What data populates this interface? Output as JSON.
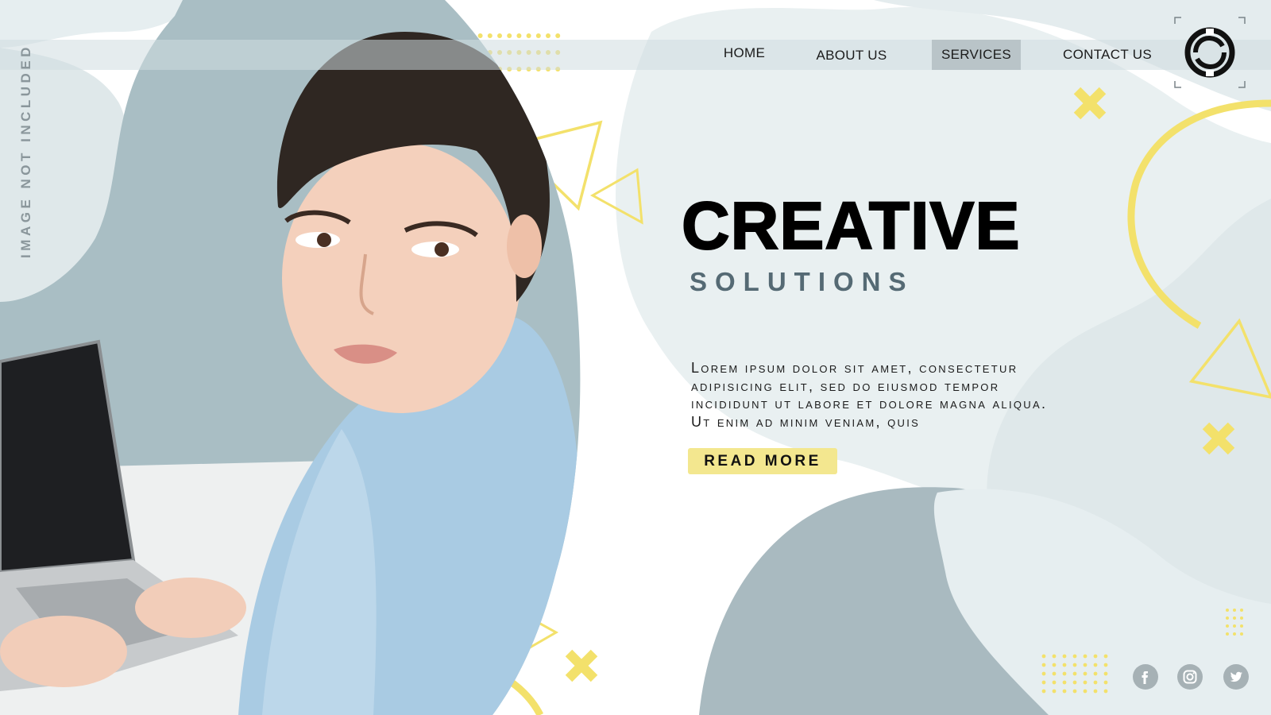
{
  "nav": {
    "items": [
      {
        "label": "HOME",
        "active": false
      },
      {
        "label": "ABOUT US",
        "active": false
      },
      {
        "label": "SERVICES",
        "active": true
      },
      {
        "label": "CONTACT US",
        "active": false
      }
    ]
  },
  "logo": {
    "icon": "circle-c-logo-icon"
  },
  "side_label": "IMAGE NOT INCLUDED",
  "hero": {
    "title": "CREATIVE",
    "subtitle": "SOLUTIONS",
    "body": "Lorem ipsum dolor sit amet, consectetur adipisicing elit, sed do eiusmod tempor incididunt ut labore et dolore magna aliqua. Ut enim ad minim veniam, quis",
    "button": "READ MORE"
  },
  "social": [
    {
      "icon": "facebook-icon"
    },
    {
      "icon": "instagram-icon"
    },
    {
      "icon": "twitter-icon"
    }
  ],
  "colors": {
    "accent_yellow": "#f3e16b",
    "blob_light": "#e9f0f1",
    "blob_mid": "#d3dfe2",
    "blob_dark": "#a9bac0",
    "subtitle": "#556a74",
    "button_bg": "#f3e78f"
  }
}
